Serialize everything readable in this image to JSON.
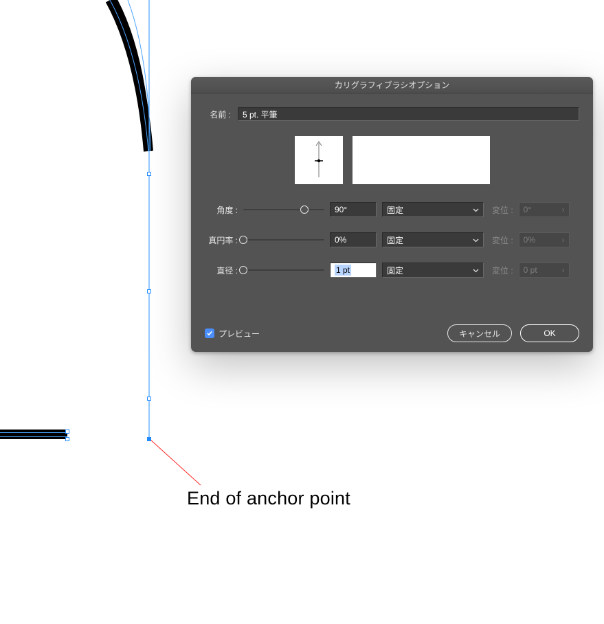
{
  "dialog": {
    "title": "カリグラフィブラシオプション",
    "name_label": "名前 :",
    "name_value": "5 pt. 平筆",
    "params": {
      "angle": {
        "label": "角度 :",
        "value": "90°",
        "mode": "固定",
        "variation_label": "変位 :",
        "variation_value": "0°",
        "slider_percent": 75
      },
      "roundness": {
        "label": "真円率 :",
        "value": "0%",
        "mode": "固定",
        "variation_label": "変位 :",
        "variation_value": "0%",
        "slider_percent": 0
      },
      "diameter": {
        "label": "直径 :",
        "value": "1 pt",
        "mode": "固定",
        "variation_label": "変位 :",
        "variation_value": "0 pt",
        "slider_percent": 0
      }
    },
    "preview_checkbox": {
      "label": "プレビュー",
      "checked": true
    },
    "buttons": {
      "cancel": "キャンセル",
      "ok": "OK"
    }
  },
  "annotation": {
    "text": "End of anchor point"
  }
}
